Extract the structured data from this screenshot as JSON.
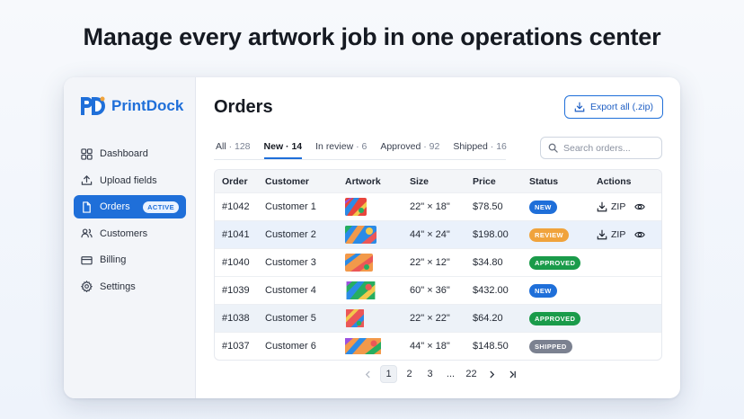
{
  "headline": "Manage every artwork job in one operations center",
  "brand": {
    "name": "PrintDock",
    "logo_icon": "pd-logo-icon"
  },
  "sidebar": {
    "items": [
      {
        "label": "Dashboard",
        "icon": "dashboard-icon"
      },
      {
        "label": "Upload fields",
        "icon": "upload-icon"
      },
      {
        "label": "Orders",
        "icon": "document-icon",
        "badge": "ACTIVE",
        "active": true
      },
      {
        "label": "Customers",
        "icon": "users-icon"
      },
      {
        "label": "Billing",
        "icon": "credit-card-icon"
      },
      {
        "label": "Settings",
        "icon": "gear-icon"
      }
    ]
  },
  "main": {
    "title": "Orders",
    "export_label": "Export all (.zip)",
    "search_placeholder": "Search orders...",
    "tabs": [
      {
        "label": "All",
        "count": "· 128"
      },
      {
        "label": "New",
        "count": "· 14",
        "active": true
      },
      {
        "label": "In review",
        "count": "· 6"
      },
      {
        "label": "Approved",
        "count": "· 92"
      },
      {
        "label": "Shipped",
        "count": "· 16"
      }
    ]
  },
  "table": {
    "columns": [
      "Order",
      "Customer",
      "Artwork",
      "Size",
      "Price",
      "Status",
      "Actions"
    ],
    "rows": [
      {
        "order": "#1042",
        "customer": "Customer 1",
        "size": "22\" × 18\"",
        "price": "$78.50",
        "status": "NEW"
      },
      {
        "order": "#1041",
        "customer": "Customer 2",
        "size": "44\" × 24\"",
        "price": "$198.00",
        "status": "REVIEW"
      },
      {
        "order": "#1040",
        "customer": "Customer 3",
        "size": "22\" × 12\"",
        "price": "$34.80",
        "status": "APPROVED"
      },
      {
        "order": "#1039",
        "customer": "Customer 4",
        "size": "60\" × 36\"",
        "price": "$432.00",
        "status": "NEW"
      },
      {
        "order": "#1038",
        "customer": "Customer 5",
        "size": "22\" × 22\"",
        "price": "$64.20",
        "status": "APPROVED"
      },
      {
        "order": "#1037",
        "customer": "Customer 6",
        "size": "44\" × 18\"",
        "price": "$148.50",
        "status": "SHIPPED"
      }
    ],
    "zip_label": "ZIP"
  },
  "pagination": {
    "pages": [
      "1",
      "2",
      "3"
    ],
    "ellipsis": "...",
    "last": "22",
    "current": "1"
  },
  "colors": {
    "accent": "#1f6fd9",
    "status_new": "#1f6fd9",
    "status_review": "#f0a33c",
    "status_approved": "#1a9b4a",
    "status_shipped": "#7b8190"
  }
}
